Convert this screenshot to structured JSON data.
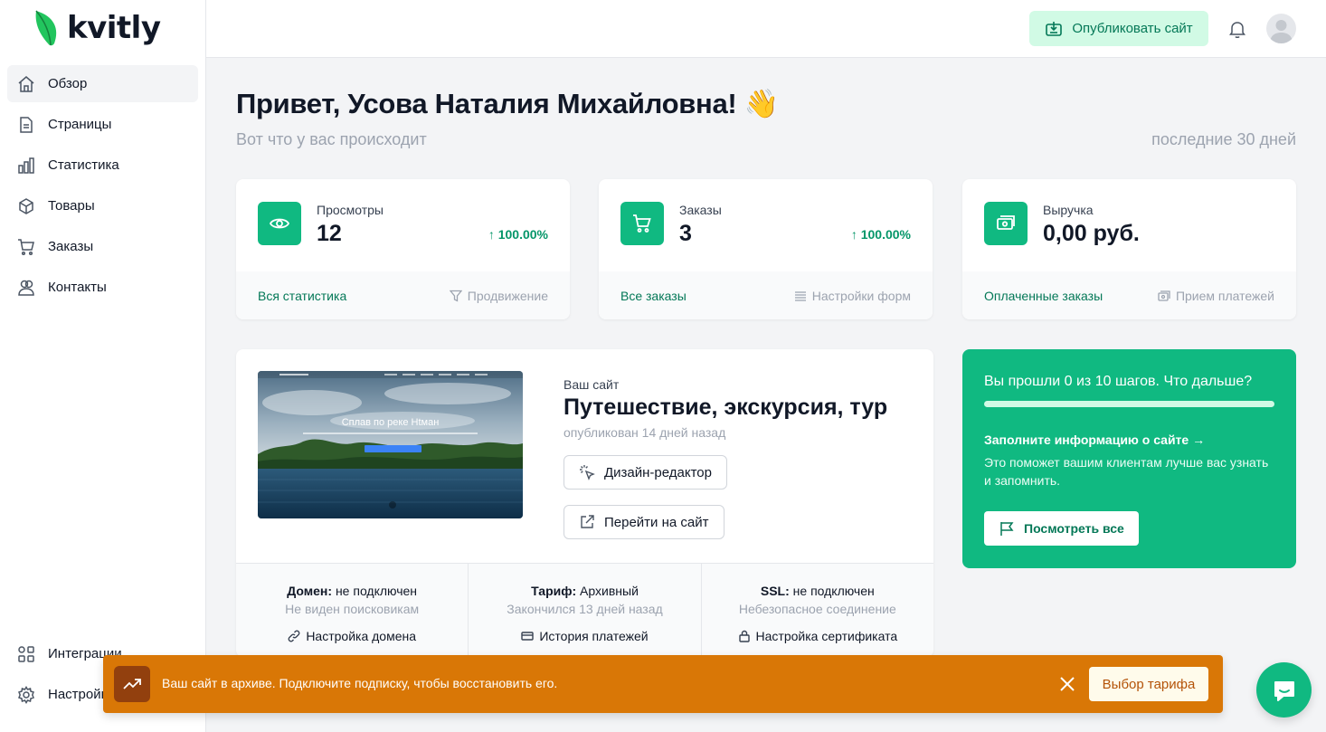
{
  "brand": {
    "name": "kvitly",
    "accent": "#10b981"
  },
  "sidebar": {
    "items": [
      {
        "label": "Обзор",
        "icon": "home-icon"
      },
      {
        "label": "Страницы",
        "icon": "document-icon"
      },
      {
        "label": "Статистика",
        "icon": "chart-icon"
      },
      {
        "label": "Товары",
        "icon": "box-icon"
      },
      {
        "label": "Заказы",
        "icon": "cart-icon"
      },
      {
        "label": "Контакты",
        "icon": "users-icon"
      }
    ],
    "bottom": [
      {
        "label": "Интеграции",
        "icon": "puzzle-icon"
      },
      {
        "label": "Настройки",
        "icon": "gear-icon"
      }
    ]
  },
  "topbar": {
    "publish_label": "Опубликовать сайт"
  },
  "main": {
    "greeting": "Привет, Усова Наталия Михайловна! 👋",
    "subline": "Вот что у вас происходит",
    "period": "последние 30 дней"
  },
  "stats": [
    {
      "label": "Просмотры",
      "value": "12",
      "delta": "↑ 100.00%",
      "link": "Вся статистика",
      "secondary": "Продвижение",
      "icon": "eye-icon"
    },
    {
      "label": "Заказы",
      "value": "3",
      "delta": "↑ 100.00%",
      "link": "Все заказы",
      "secondary": "Настройки форм",
      "icon": "cart-icon"
    },
    {
      "label": "Выручка",
      "value": "0,00 руб.",
      "delta": "",
      "link": "Оплаченные заказы",
      "secondary": "Прием платежей",
      "icon": "cash-icon"
    }
  ],
  "site": {
    "caption": "Ваш сайт",
    "title": "Путешествие, экскурсия, тур",
    "meta": "опубликован 14 дней назад",
    "design_label": "Дизайн-редактор",
    "visit_label": "Перейти на сайт",
    "thumb_heading": "Сплав по реке Htман",
    "info": [
      {
        "key": "Домен:",
        "value": " не подключен",
        "note": "Не виден поисковикам",
        "action": "Настройка домена"
      },
      {
        "key": "Тариф:",
        "value": " Архивный",
        "note": "Закончился 13 дней назад",
        "action": "История платежей"
      },
      {
        "key": "SSL:",
        "value": " не подключен",
        "note": "Небезопасное соединение",
        "action": "Настройка сертификата"
      }
    ]
  },
  "steps": {
    "title": "Вы прошли 0 из 10 шагов. Что дальше?",
    "progress": 0,
    "link": "Заполните информацию о сайте →",
    "desc": "Это поможет вашим клиентам лучше вас узнать и запомнить.",
    "button": "Посмотреть все"
  },
  "banner": {
    "text": "Ваш сайт в архиве. Подключите подписку, чтобы восстановить его.",
    "button": "Выбор тарифа",
    "color": "#d97706"
  }
}
